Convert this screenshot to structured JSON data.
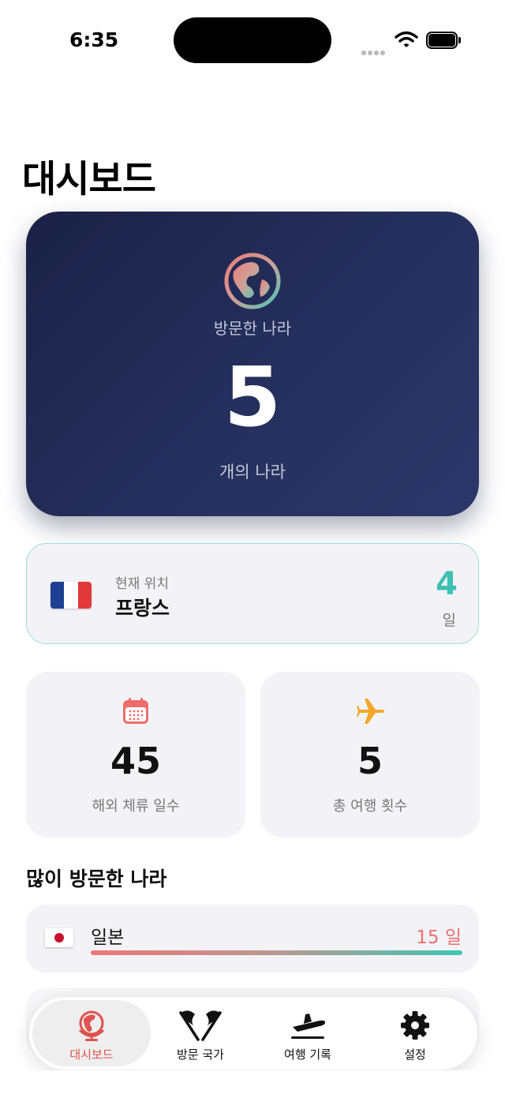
{
  "status_bar": {
    "time": "6:35"
  },
  "page": {
    "title": "대시보드"
  },
  "hero": {
    "label": "방문한 나라",
    "count": "5",
    "unit": "개의 나라",
    "icon": "globe-icon"
  },
  "current_location": {
    "label": "현재 위치",
    "country": "프랑스",
    "days": "4",
    "days_unit": "일",
    "flag": "flag-france-icon"
  },
  "stats": [
    {
      "icon": "calendar-icon",
      "value": "45",
      "label": "해외 체류 일수"
    },
    {
      "icon": "airplane-icon",
      "value": "5",
      "label": "총 여행 횟수"
    }
  ],
  "top_countries": {
    "title": "많이 방문한 나라",
    "items": [
      {
        "flag": "flag-japan-icon",
        "name": "일본",
        "days": "15 일",
        "share": 1.0
      }
    ]
  },
  "tabbar": {
    "tabs": [
      {
        "label": "대시보드",
        "icon": "globe-icon",
        "active": true
      },
      {
        "label": "방문 국가",
        "icon": "crossed-flags-icon",
        "active": false
      },
      {
        "label": "여행 기록",
        "icon": "airplane-departure-icon",
        "active": false
      },
      {
        "label": "설정",
        "icon": "gear-icon",
        "active": false
      }
    ]
  },
  "colors": {
    "accent_red": "#e0524f",
    "accent_teal": "#3cc0b2",
    "hero_bg": "#232a55",
    "card_bg": "#f3f3f7"
  }
}
